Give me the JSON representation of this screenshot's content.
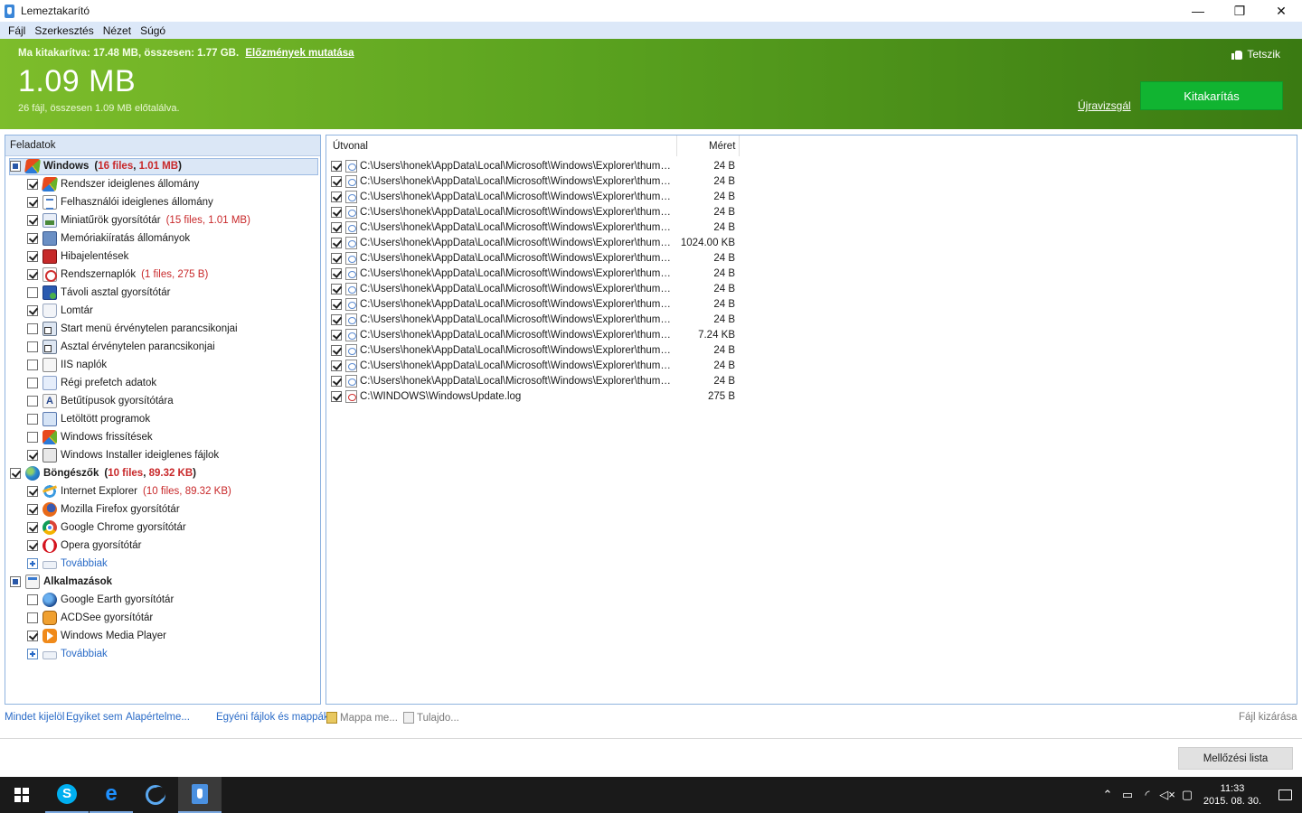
{
  "window": {
    "title": "Lemeztakarító",
    "minimize": "—",
    "restore": "❐",
    "close": "✕"
  },
  "menu": [
    "Fájl",
    "Szerkesztés",
    "Nézet",
    "Súgó"
  ],
  "header": {
    "summary": "Ma kitakarítva: 17.48 MB, összesen: 1.77 GB.",
    "history_link": "Előzmények mutatása",
    "size": "1.09 MB",
    "found": "26 fájl, összesen 1.09 MB előtalálva.",
    "like": "Tetszik",
    "reanalyze": "Újravizsgál",
    "clean_button": "Kitakarítás"
  },
  "tasks": {
    "heading": "Feladatok",
    "items": [
      {
        "label": "Windows",
        "group": true,
        "state": "partial",
        "icon": "windows",
        "files": "16 files",
        "size": "1.01 MB",
        "selected": true
      },
      {
        "label": "Rendszer ideiglenes állomány",
        "state": "checked",
        "icon": "windows"
      },
      {
        "label": "Felhasználói ideiglenes állomány",
        "state": "checked",
        "icon": "doc"
      },
      {
        "label": "Miniatűrök gyorsítótár",
        "state": "checked",
        "icon": "img",
        "files": "15 files",
        "size": "1.01 MB"
      },
      {
        "label": "Memóriakiíratás állományok",
        "state": "checked",
        "icon": "chip"
      },
      {
        "label": "Hibajelentések",
        "state": "checked",
        "icon": "red"
      },
      {
        "label": "Rendszernaplók",
        "state": "checked",
        "icon": "log",
        "files": "1 files",
        "size": "275 B"
      },
      {
        "label": "Távoli asztal gyorsítótár",
        "state": "unchecked",
        "icon": "remote"
      },
      {
        "label": "Lomtár",
        "state": "checked",
        "icon": "bin"
      },
      {
        "label": "Start menü érvénytelen parancsikonjai",
        "state": "unchecked",
        "icon": "shortcut"
      },
      {
        "label": "Asztal érvénytelen parancsikonjai",
        "state": "unchecked",
        "icon": "shortcut"
      },
      {
        "label": "IIS naplók",
        "state": "unchecked",
        "icon": "iis"
      },
      {
        "label": "Régi prefetch adatok",
        "state": "unchecked",
        "icon": "prefetch"
      },
      {
        "label": "Betűtípusok gyorsítótára",
        "state": "unchecked",
        "icon": "font"
      },
      {
        "label": "Letöltött programok",
        "state": "unchecked",
        "icon": "download"
      },
      {
        "label": "Windows frissítések",
        "state": "unchecked",
        "icon": "update"
      },
      {
        "label": "Windows Installer ideiglenes fájlok",
        "state": "checked",
        "icon": "installer"
      },
      {
        "label": "Böngészők",
        "group": true,
        "state": "checked",
        "icon": "globe",
        "files": "10 files",
        "size": "89.32 KB"
      },
      {
        "label": "Internet Explorer",
        "state": "checked",
        "icon": "ie",
        "files": "10 files",
        "size": "89.32 KB"
      },
      {
        "label": "Mozilla Firefox gyorsítótár",
        "state": "checked",
        "icon": "firefox"
      },
      {
        "label": "Google Chrome gyorsítótár",
        "state": "checked",
        "icon": "chrome"
      },
      {
        "label": "Opera gyorsítótár",
        "state": "checked",
        "icon": "opera"
      },
      {
        "label": "Továbbiak",
        "state": "plus",
        "icon": "more",
        "link": true
      },
      {
        "label": "Alkalmazások",
        "group": true,
        "state": "partial",
        "icon": "apps"
      },
      {
        "label": "Google Earth gyorsítótár",
        "state": "unchecked",
        "icon": "earth"
      },
      {
        "label": "ACDSee gyorsítótár",
        "state": "unchecked",
        "icon": "acdsee"
      },
      {
        "label": "Windows Media Player",
        "state": "checked",
        "icon": "wmp"
      },
      {
        "label": "Továbbiak",
        "state": "plus",
        "icon": "more",
        "link": true
      }
    ]
  },
  "files": {
    "col_path": "Útvonal",
    "col_size": "Méret",
    "rows": [
      {
        "path": "C:\\Users\\honek\\AppData\\Local\\Microsoft\\Windows\\Explorer\\thumbca...",
        "size": "24 B"
      },
      {
        "path": "C:\\Users\\honek\\AppData\\Local\\Microsoft\\Windows\\Explorer\\thumbca...",
        "size": "24 B"
      },
      {
        "path": "C:\\Users\\honek\\AppData\\Local\\Microsoft\\Windows\\Explorer\\thumbca...",
        "size": "24 B"
      },
      {
        "path": "C:\\Users\\honek\\AppData\\Local\\Microsoft\\Windows\\Explorer\\thumbca...",
        "size": "24 B"
      },
      {
        "path": "C:\\Users\\honek\\AppData\\Local\\Microsoft\\Windows\\Explorer\\thumbca...",
        "size": "24 B"
      },
      {
        "path": "C:\\Users\\honek\\AppData\\Local\\Microsoft\\Windows\\Explorer\\thumbca...",
        "size": "1024.00 KB"
      },
      {
        "path": "C:\\Users\\honek\\AppData\\Local\\Microsoft\\Windows\\Explorer\\thumbca...",
        "size": "24 B"
      },
      {
        "path": "C:\\Users\\honek\\AppData\\Local\\Microsoft\\Windows\\Explorer\\thumbca...",
        "size": "24 B"
      },
      {
        "path": "C:\\Users\\honek\\AppData\\Local\\Microsoft\\Windows\\Explorer\\thumbca...",
        "size": "24 B"
      },
      {
        "path": "C:\\Users\\honek\\AppData\\Local\\Microsoft\\Windows\\Explorer\\thumbca...",
        "size": "24 B"
      },
      {
        "path": "C:\\Users\\honek\\AppData\\Local\\Microsoft\\Windows\\Explorer\\thumbca...",
        "size": "24 B"
      },
      {
        "path": "C:\\Users\\honek\\AppData\\Local\\Microsoft\\Windows\\Explorer\\thumbca...",
        "size": "7.24 KB"
      },
      {
        "path": "C:\\Users\\honek\\AppData\\Local\\Microsoft\\Windows\\Explorer\\thumbca...",
        "size": "24 B"
      },
      {
        "path": "C:\\Users\\honek\\AppData\\Local\\Microsoft\\Windows\\Explorer\\thumbca...",
        "size": "24 B"
      },
      {
        "path": "C:\\Users\\honek\\AppData\\Local\\Microsoft\\Windows\\Explorer\\thumbca...",
        "size": "24 B"
      },
      {
        "path": "C:\\WINDOWS\\WindowsUpdate.log",
        "size": "275 B",
        "log": true
      }
    ]
  },
  "bottom": {
    "select_all": "Mindet kijelöl",
    "select_none": "Egyiket sem",
    "defaults": "Alapértelme...",
    "custom": "Egyéni fájlok és mappák",
    "folder": "Mappa me...",
    "properties": "Tulajdo...",
    "exclude": "Fájl kizárása",
    "ignore_list": "Mellőzési lista"
  },
  "taskbar": {
    "time": "11:33",
    "date": "2015. 08. 30."
  },
  "colors": {
    "header_green": "#5aa21f",
    "clean_button": "#11b431",
    "highlight_red": "#c8282a",
    "link_blue": "#2a6bc7"
  }
}
